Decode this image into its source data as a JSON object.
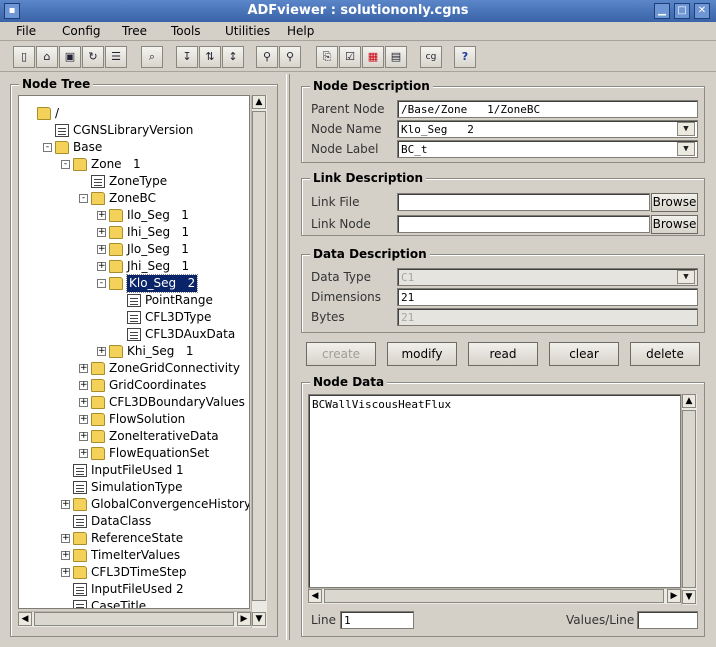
{
  "window": {
    "title": "ADFviewer : solutiononly.cgns"
  },
  "menu": [
    "File",
    "Config",
    "Tree",
    "Tools",
    "Utilities",
    "Help"
  ],
  "toolbar_icons": [
    "new-icon",
    "open-icon",
    "save-icon",
    "refresh-icon",
    "properties-icon",
    "print-preview-icon",
    "tree-expand-icon",
    "tree-sort-icon",
    "tree-list-icon",
    "find-icon",
    "find-next-icon",
    "copy-icon",
    "check-icon",
    "grid-icon",
    "table-icon",
    "cgns-icon",
    "help-icon"
  ],
  "tree": {
    "title": "Node Tree",
    "nodes": [
      {
        "label": "/",
        "depth": 0,
        "icon": "folder",
        "exp": ""
      },
      {
        "label": "CGNSLibraryVersion",
        "depth": 1,
        "icon": "doc",
        "exp": ""
      },
      {
        "label": "Base",
        "depth": 1,
        "icon": "folder",
        "exp": "-"
      },
      {
        "label": "Zone   1",
        "depth": 2,
        "icon": "folder",
        "exp": "-"
      },
      {
        "label": "ZoneType",
        "depth": 3,
        "icon": "doc",
        "exp": ""
      },
      {
        "label": "ZoneBC",
        "depth": 3,
        "icon": "folder",
        "exp": "-"
      },
      {
        "label": "Ilo_Seg   1",
        "depth": 4,
        "icon": "folder",
        "exp": "+"
      },
      {
        "label": "Ihi_Seg   1",
        "depth": 4,
        "icon": "folder",
        "exp": "+"
      },
      {
        "label": "Jlo_Seg   1",
        "depth": 4,
        "icon": "folder",
        "exp": "+"
      },
      {
        "label": "Jhi_Seg   1",
        "depth": 4,
        "icon": "folder",
        "exp": "+"
      },
      {
        "label": "Klo_Seg   2",
        "depth": 4,
        "icon": "folder",
        "exp": "-",
        "selected": true
      },
      {
        "label": "PointRange",
        "depth": 5,
        "icon": "doc",
        "exp": ""
      },
      {
        "label": "CFL3DType",
        "depth": 5,
        "icon": "doc",
        "exp": ""
      },
      {
        "label": "CFL3DAuxData",
        "depth": 5,
        "icon": "doc",
        "exp": ""
      },
      {
        "label": "Khi_Seg   1",
        "depth": 4,
        "icon": "folder",
        "exp": "+"
      },
      {
        "label": "ZoneGridConnectivity",
        "depth": 3,
        "icon": "folder",
        "exp": "+"
      },
      {
        "label": "GridCoordinates",
        "depth": 3,
        "icon": "folder",
        "exp": "+"
      },
      {
        "label": "CFL3DBoundaryValues",
        "depth": 3,
        "icon": "folder",
        "exp": "+"
      },
      {
        "label": "FlowSolution",
        "depth": 3,
        "icon": "folder",
        "exp": "+"
      },
      {
        "label": "ZoneIterativeData",
        "depth": 3,
        "icon": "folder",
        "exp": "+"
      },
      {
        "label": "FlowEquationSet",
        "depth": 3,
        "icon": "folder",
        "exp": "+"
      },
      {
        "label": "InputFileUsed 1",
        "depth": 2,
        "icon": "doc",
        "exp": ""
      },
      {
        "label": "SimulationType",
        "depth": 2,
        "icon": "doc",
        "exp": ""
      },
      {
        "label": "GlobalConvergenceHistory",
        "depth": 2,
        "icon": "folder",
        "exp": "+"
      },
      {
        "label": "DataClass",
        "depth": 2,
        "icon": "doc",
        "exp": ""
      },
      {
        "label": "ReferenceState",
        "depth": 2,
        "icon": "folder",
        "exp": "+"
      },
      {
        "label": "TimeIterValues",
        "depth": 2,
        "icon": "folder",
        "exp": "+"
      },
      {
        "label": "CFL3DTimeStep",
        "depth": 2,
        "icon": "folder",
        "exp": "+"
      },
      {
        "label": "InputFileUsed 2",
        "depth": 2,
        "icon": "doc",
        "exp": ""
      },
      {
        "label": "CaseTitle",
        "depth": 2,
        "icon": "doc",
        "exp": ""
      }
    ]
  },
  "node_description": {
    "title": "Node Description",
    "parent_label": "Parent Node",
    "parent_value": "/Base/Zone   1/ZoneBC",
    "name_label": "Node Name",
    "name_value": "Klo_Seg   2",
    "type_label": "Node Label",
    "type_value": "BC_t"
  },
  "link_description": {
    "title": "Link Description",
    "file_label": "Link File",
    "file_value": "",
    "node_label": "Link Node",
    "node_value": "",
    "browse": "Browse"
  },
  "data_description": {
    "title": "Data Description",
    "type_label": "Data Type",
    "type_value": "C1",
    "dims_label": "Dimensions",
    "dims_value": "21",
    "bytes_label": "Bytes",
    "bytes_value": "21"
  },
  "actions": {
    "create": "create",
    "modify": "modify",
    "read": "read",
    "clear": "clear",
    "delete": "delete"
  },
  "node_data": {
    "title": "Node Data",
    "content": "BCWallViscousHeatFlux",
    "line_label": "Line",
    "line_value": "1",
    "values_label": "Values/Line",
    "values_value": ""
  }
}
